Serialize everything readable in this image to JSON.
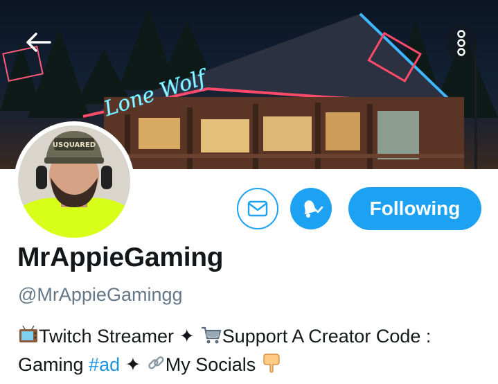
{
  "banner": {
    "sign_text": "Lone Wolf",
    "back_icon": "arrow-left-icon",
    "more_icon": "more-vertical-icon"
  },
  "profile": {
    "display_name": "MrAppieGaming",
    "handle": "@MrAppieGamingg",
    "avatar_cap_text": "USQUARED"
  },
  "actions": {
    "message_icon": "envelope-icon",
    "notify_icon": "bell-check-icon",
    "follow_label": "Following"
  },
  "bio": {
    "part1": "Twitch Streamer ✦ ",
    "part2": "Support A Creator Code : Gaming ",
    "hashtag": "#ad",
    "part3": " ✦ ",
    "part4": "My Socials "
  },
  "colors": {
    "accent": "#1da1f2",
    "text_primary": "#14171a",
    "text_secondary": "#657786",
    "hashtag": "#1b95e0"
  }
}
